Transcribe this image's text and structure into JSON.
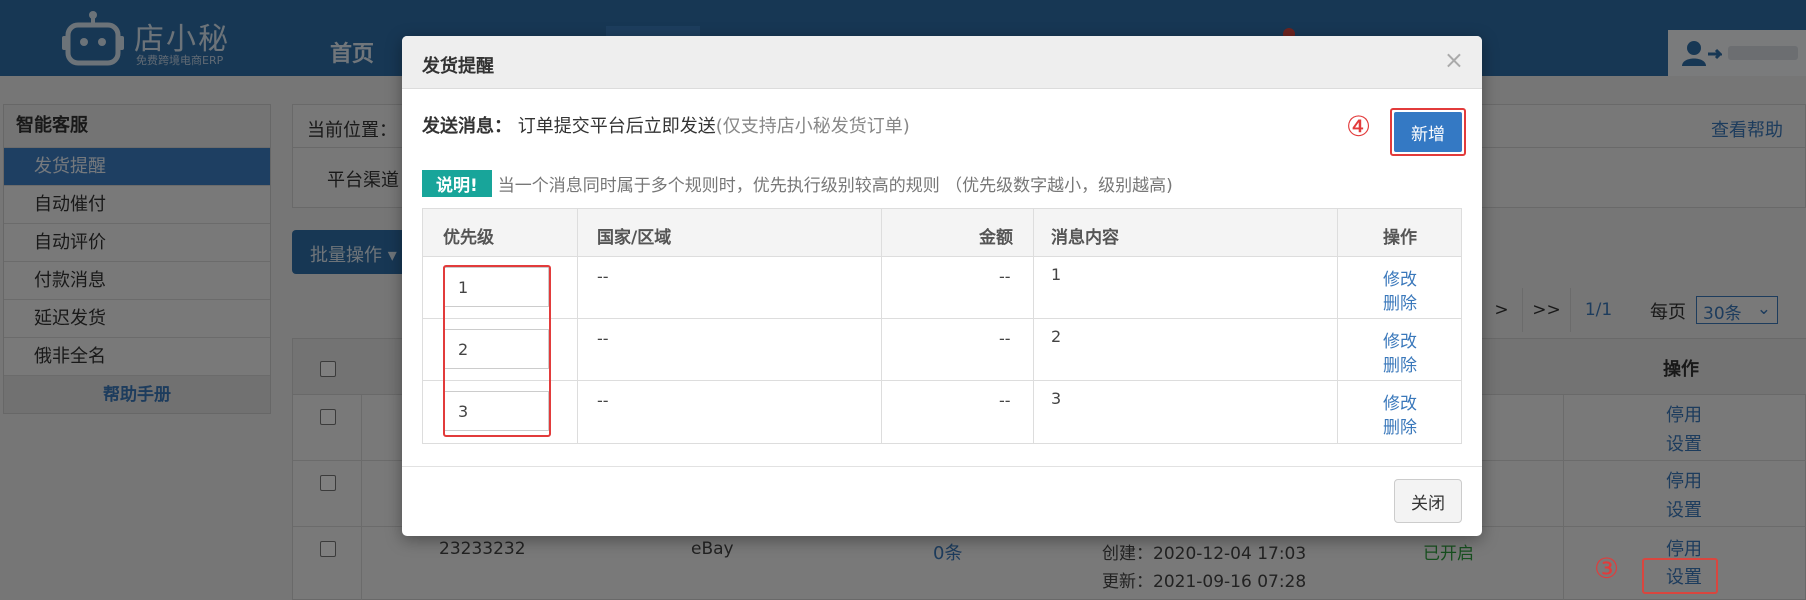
{
  "header": {
    "logo_name": "店小秘",
    "logo_sub": "免费跨境电商ERP",
    "nav_home": "首页"
  },
  "sidebar": {
    "title": "智能客服",
    "items": [
      {
        "label": "发货提醒",
        "active": true
      },
      {
        "label": "自动催付"
      },
      {
        "label": "自动评价"
      },
      {
        "label": "付款消息"
      },
      {
        "label": "延迟发货"
      },
      {
        "label": "俄非全名"
      }
    ],
    "help": "帮助手册"
  },
  "main": {
    "crumb": "当前位置：",
    "help_link": "查看帮助",
    "filter_label": "平台渠道：",
    "batch_label": "批量操作",
    "pager": {
      "next": ">",
      "last": ">>",
      "page": "1/1",
      "per_page_label": "每页",
      "per_page_value": "30条"
    },
    "table_ops_header": "操作",
    "rows": [
      {
        "ops": [
          "停用",
          "设置"
        ]
      },
      {
        "ops": [
          "停用",
          "设置"
        ]
      },
      {
        "id": "23233232",
        "platform": "eBay",
        "count": "0条",
        "created": "创建：2020-12-04 17:03",
        "updated": "更新：2021-09-16 07:28",
        "status": "已开启",
        "ops": [
          "停用",
          "设置"
        ]
      }
    ]
  },
  "markers": {
    "three": "③",
    "four": "④"
  },
  "modal": {
    "title": "发货提醒",
    "close_x": "×",
    "send_label": "发送消息：",
    "send_value": "订单提交平台后立即发送",
    "send_note": "(仅支持店小秘发货订单)",
    "note_badge": "说明!",
    "note_text": "当一个消息同时属于多个规则时，优先执行级别较高的规则 （优先级数字越小，级别越高)",
    "add_label": "新增",
    "columns": [
      "优先级",
      "国家/区域",
      "金额",
      "消息内容",
      "操作"
    ],
    "rules": [
      {
        "priority": "1",
        "region": "--",
        "amount": "--",
        "content": "1",
        "edit": "修改",
        "delete": "删除"
      },
      {
        "priority": "2",
        "region": "--",
        "amount": "--",
        "content": "2",
        "edit": "修改",
        "delete": "删除"
      },
      {
        "priority": "3",
        "region": "--",
        "amount": "--",
        "content": "3",
        "edit": "修改",
        "delete": "删除"
      }
    ],
    "close_label": "关闭"
  }
}
